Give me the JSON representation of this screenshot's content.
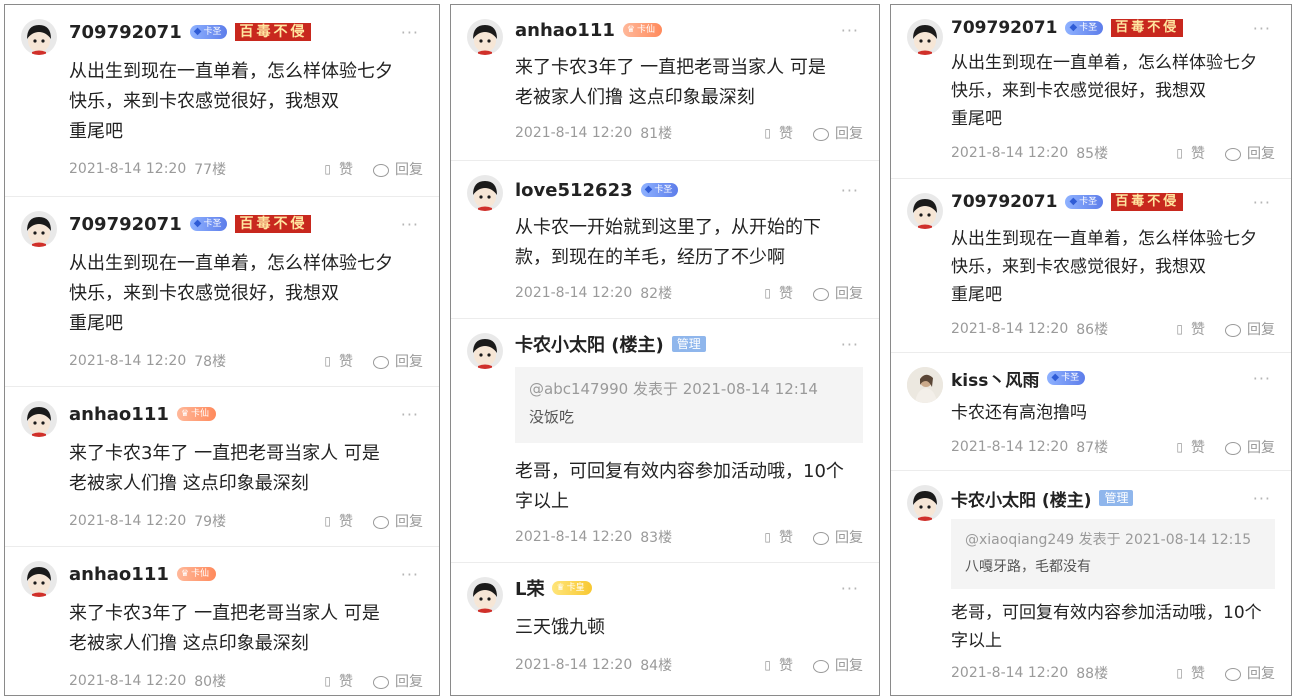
{
  "panel1": {
    "posts": [
      {
        "username": "709792071",
        "badge": "卡圣",
        "title_badge": "百毒不侵",
        "text_lines": [
          "从出生到现在一直单着，怎么样体验七夕",
          "快乐￼￼￼，来到卡农感觉很好，我想双",
          "重尾吧"
        ],
        "timestamp": "2021-8-14 12:20",
        "floor": "77楼",
        "like_label": "赞",
        "reply_label": "回复"
      },
      {
        "username": "709792071",
        "badge": "卡圣",
        "title_badge": "百毒不侵",
        "text_lines": [
          "从出生到现在一直单着，怎么样体验七夕",
          "快乐￼￼￼，来到卡农感觉很好，我想双",
          "重尾吧"
        ],
        "timestamp": "2021-8-14 12:20",
        "floor": "78楼",
        "like_label": "赞",
        "reply_label": "回复"
      },
      {
        "username": "anhao111",
        "badge": "卡仙",
        "text_lines": [
          "来了卡农3年了  一直把老哥当家人  可是",
          "老被家人们撸  这点印象最深刻"
        ],
        "timestamp": "2021-8-14 12:20",
        "floor": "79楼",
        "like_label": "赞",
        "reply_label": "回复"
      },
      {
        "username": "anhao111",
        "badge": "卡仙",
        "text_lines": [
          "来了卡农3年了  一直把老哥当家人  可是",
          "老被家人们撸  这点印象最深刻"
        ],
        "timestamp": "2021-8-14 12:20",
        "floor": "80楼",
        "like_label": "赞",
        "reply_label": "回复"
      }
    ]
  },
  "panel2": {
    "posts": [
      {
        "username": "anhao111",
        "badge": "卡仙",
        "text_lines": [
          "来了卡农3年了  一直把老哥当家人  可是",
          "老被家人们撸  这点印象最深刻"
        ],
        "timestamp": "2021-8-14 12:20",
        "floor": "81楼",
        "like_label": "赞",
        "reply_label": "回复"
      },
      {
        "username": "love512623",
        "badge": "卡圣",
        "text_lines": [
          "从卡农一开始就到这里了，从开始的下",
          "款，到现在的羊毛，经历了不少啊"
        ],
        "timestamp": "2021-8-14 12:20",
        "floor": "82楼",
        "like_label": "赞",
        "reply_label": "回复"
      },
      {
        "username": "卡农小太阳 (楼主)",
        "role_badge": "管理",
        "quote_meta": "@abc147990 发表于 2021-08-14 12:14",
        "quote_text": "没饭吃",
        "text_lines": [
          "老哥，可回复有效内容参加活动哦，10个",
          "字以上"
        ],
        "timestamp": "2021-8-14 12:20",
        "floor": "83楼",
        "like_label": "赞",
        "reply_label": "回复"
      },
      {
        "username": "L荣",
        "badge": "卡皇",
        "text_lines": [
          "三天饿九顿"
        ],
        "timestamp": "2021-8-14 12:20",
        "floor": "84楼",
        "like_label": "赞",
        "reply_label": "回复"
      }
    ]
  },
  "panel3": {
    "posts": [
      {
        "username": "709792071",
        "badge": "卡圣",
        "title_badge": "百毒不侵",
        "text_lines": [
          "从出生到现在一直单着，怎么样体验七夕",
          "快乐￼￼￼，来到卡农感觉很好，我想双",
          "重尾吧"
        ],
        "timestamp": "2021-8-14 12:20",
        "floor": "85楼",
        "like_label": "赞",
        "reply_label": "回复"
      },
      {
        "username": "709792071",
        "badge": "卡圣",
        "title_badge": "百毒不侵",
        "text_lines": [
          "从出生到现在一直单着，怎么样体验七夕",
          "快乐￼￼￼，来到卡农感觉很好，我想双",
          "重尾吧"
        ],
        "timestamp": "2021-8-14 12:20",
        "floor": "86楼",
        "like_label": "赞",
        "reply_label": "回复"
      },
      {
        "username": "kiss丶风雨",
        "badge": "卡圣",
        "text_lines": [
          "卡农还有高泡撸吗"
        ],
        "timestamp": "2021-8-14 12:20",
        "floor": "87楼",
        "like_label": "赞",
        "reply_label": "回复"
      },
      {
        "username": "卡农小太阳 (楼主)",
        "role_badge": "管理",
        "quote_meta": "@xiaoqiang249 发表于 2021-08-14 12:15",
        "quote_text": "八嘎牙路，毛都没有",
        "text_lines": [
          "老哥，可回复有效内容参加活动哦，10个",
          "字以上"
        ],
        "timestamp": "2021-8-14 12:20",
        "floor": "88楼",
        "like_label": "赞",
        "reply_label": "回复"
      }
    ]
  },
  "more_label": "···",
  "icons": {
    "avatar": "cartoon-avatar-icon",
    "like": "thumb-icon",
    "reply": "speech-bubble-icon",
    "diamond": "diamond-icon"
  },
  "colors": {
    "title_badge_bg": "#c8281e",
    "manager_badge_bg": "#8fb6ec",
    "diamond_badge": "#5d7dea",
    "meta_text": "#9a9a9a"
  }
}
